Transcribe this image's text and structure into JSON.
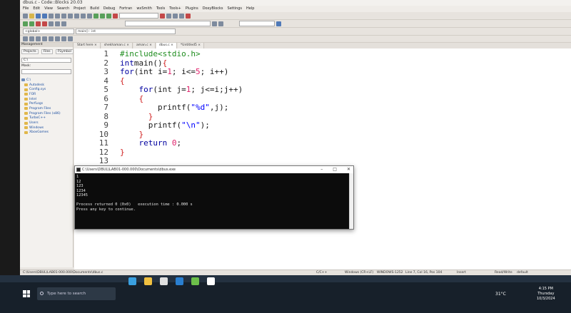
{
  "window": {
    "title": "dbus.c - Code::Blocks 20.03"
  },
  "menu": [
    "File",
    "Edit",
    "View",
    "Search",
    "Project",
    "Build",
    "Debug",
    "Fortran",
    "wxSmith",
    "Tools",
    "Tools+",
    "Plugins",
    "DoxyBlocks",
    "Settings",
    "Help"
  ],
  "toolbar": {
    "scope_combo": "<global>",
    "function_combo": "main() : int"
  },
  "management": {
    "title": "Management",
    "tabs": [
      "Projects",
      "Files",
      "FSymbol"
    ],
    "path_field": "C:\\",
    "mask_label": "Mask:",
    "tree": [
      {
        "label": "C:\\",
        "root": true
      },
      {
        "label": "Autodesk"
      },
      {
        "label": "Config.sys"
      },
      {
        "label": "FOR"
      },
      {
        "label": "Intel"
      },
      {
        "label": "PerfLogs"
      },
      {
        "label": "Program Files"
      },
      {
        "label": "Program Files (x86)"
      },
      {
        "label": "TurboC++"
      },
      {
        "label": "Users"
      },
      {
        "label": "Windows"
      },
      {
        "label": "XboxGames"
      }
    ]
  },
  "editor_tabs": [
    {
      "label": "Start here",
      "active": false
    },
    {
      "label": "shekhaman.c",
      "active": false
    },
    {
      "label": "aman.c",
      "active": false
    },
    {
      "label": "dbus.c",
      "active": true
    },
    {
      "label": "*Untitled5",
      "active": false
    }
  ],
  "code_lines": [
    {
      "n": "1",
      "html_parts": [
        [
          "pp",
          "#include<stdio.h>"
        ]
      ]
    },
    {
      "n": "2",
      "html_parts": [
        [
          "kw",
          "int"
        ],
        [
          "",
          "main()"
        ],
        [
          "br",
          "{"
        ]
      ]
    },
    {
      "n": "3",
      "html_parts": [
        [
          "kw",
          "for"
        ],
        [
          "",
          "(int i="
        ],
        [
          "num",
          "1"
        ],
        [
          "",
          "; i<="
        ],
        [
          "num",
          "5"
        ],
        [
          "",
          "; i++)"
        ]
      ]
    },
    {
      "n": "4",
      "html_parts": [
        [
          "br",
          "{"
        ]
      ]
    },
    {
      "n": "5",
      "html_parts": [
        [
          "",
          "    "
        ],
        [
          "kw",
          "for"
        ],
        [
          "",
          "(int j="
        ],
        [
          "num",
          "1"
        ],
        [
          "",
          "; j<=i;j++)"
        ]
      ]
    },
    {
      "n": "6",
      "html_parts": [
        [
          "",
          "    "
        ],
        [
          "br",
          "{"
        ]
      ]
    },
    {
      "n": "7",
      "html_parts": [
        [
          "",
          "        printf("
        ],
        [
          "str",
          "\"%d\""
        ],
        [
          "",
          ",j);"
        ]
      ]
    },
    {
      "n": "8",
      "html_parts": [
        [
          "",
          "      "
        ],
        [
          "br",
          "}"
        ]
      ]
    },
    {
      "n": "9",
      "html_parts": [
        [
          "",
          "      printf("
        ],
        [
          "str",
          "\"\\n\""
        ],
        [
          "",
          ");"
        ]
      ]
    },
    {
      "n": "10",
      "html_parts": [
        [
          "",
          "    "
        ],
        [
          "br",
          "}"
        ]
      ]
    },
    {
      "n": "11",
      "html_parts": [
        [
          "",
          "    "
        ],
        [
          "kw",
          "return"
        ],
        [
          "",
          ""
        ],
        [
          "num",
          " 0"
        ],
        [
          "",
          ";"
        ]
      ]
    },
    {
      "n": "12",
      "html_parts": [
        [
          "br",
          "}"
        ]
      ]
    },
    {
      "n": "13",
      "html_parts": [
        [
          "",
          ""
        ]
      ]
    }
  ],
  "console": {
    "title": "C:\\Users\\DBUL\\LAB01-000.000\\Documents\\dbus.exe",
    "output": "1\n12\n123\n1234\n12345\n\nProcess returned 0 (0x0)   execution time : 0.000 s\nPress any key to continue."
  },
  "statusbar": {
    "path": "C:\\Users\\DBUL\\LAB01-000.000\\Documents\\dbus.c",
    "lang": "C/C++",
    "eol": "Windows (CR+LF)",
    "encoding": "WINDOWS-1252",
    "position": "Line 7, Col 16, Pos 104",
    "mode": "Insert",
    "rw": "Read/Write",
    "profile": "default"
  },
  "taskbar": {
    "search_placeholder": "Type here to search",
    "weather": "31°C",
    "time": "4:15 PM",
    "day": "Thursday",
    "date": "10/3/2024"
  }
}
